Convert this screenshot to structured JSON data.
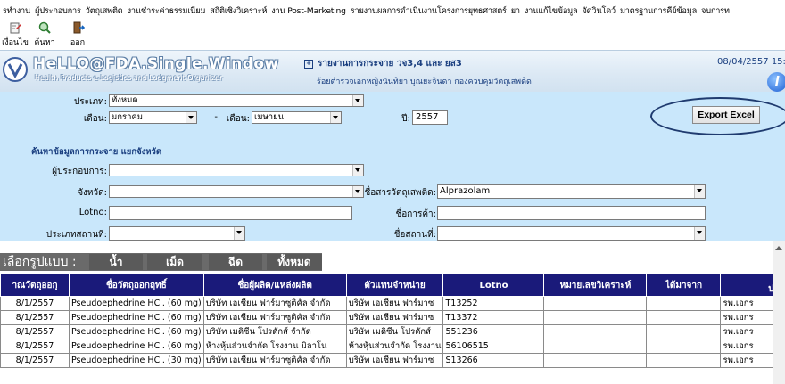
{
  "menu": [
    "รทำงาน",
    "ผู้ประกอบการ",
    "วัตถุเสพติด",
    "งานชำระค่าธรรมเนียม",
    "สถิติเชิงวิเคราะห์",
    "งาน Post-Marketing",
    "รายงานผลการดำเนินงานโครงการยุทธศาสตร์",
    "ยา",
    "งานแก้ไขข้อมูล",
    "จัดวินโดว์",
    "มาตรฐานการคีย์ข้อมูล",
    "จบการท"
  ],
  "toolbar": {
    "conditions": "เงื่อนไข",
    "search": "ค้นหา",
    "exit": "ออก"
  },
  "header": {
    "logo_title": "HeLLO@FDA.Single.Window",
    "logo_sub": "Health Products e-Logistics and Lodgment Organizer",
    "report_title": "รายงานการกระจาย วจ3,4 และ ยส3",
    "user_line": "ร้อยตำรวจเอกหญิงนันทิยา บุณยะจินดา กองควบคุมวัตถุเสพติด",
    "date": "08/04/2557 15:13"
  },
  "form": {
    "type_label": "ประเภท:",
    "type_value": "ทั้งหมด",
    "month_label": "เดือน:",
    "month_from": "มกราคม",
    "dash": "-",
    "month_to_label": "เดือน:",
    "month_to": "เมษายน",
    "year_label": "ปี:",
    "year_value": "2557",
    "section_title": "ค้นหาข้อมูลการกระจาย แยกจังหวัด",
    "operator_label": "ผู้ประกอบการ:",
    "province_label": "จังหวัด:",
    "substance_label": "ชื่อสารวัตถุเสพติด:",
    "substance_value": "Alprazolam",
    "lotno_label": "Lotno:",
    "trade_label": "ชื่อการค้า:",
    "place_type_label": "ประเภทสถานที่:",
    "place_name_label": "ชื่อสถานที่:",
    "export_label": "Export Excel"
  },
  "tabs": {
    "label": "เลือกรูปแบบ :",
    "items": [
      "น้ำ",
      "เม็ด",
      "ฉีด",
      "ทั้งหมด"
    ]
  },
  "table": {
    "headers": [
      "าณวัตถุออกุ",
      "ชื่อวัตถุออกฤทธิ์",
      "ชื่อผู้ผลิต/แหล่งผลิต",
      "ตัวแทนจำหน่าย",
      "Lotno",
      "หมายเลขวิเคราะห์",
      "ได้มาจาก",
      "ป"
    ],
    "rows": [
      [
        "8/1/2557",
        "Pseudoephedrine HCl. (60 mg)",
        "บริษัท เอเชียน ฟาร์มาซูติคัล จำกัด",
        "บริษัท เอเชียน ฟาร์มาซ",
        "T13252",
        "",
        "",
        "รพ.เอกร"
      ],
      [
        "8/1/2557",
        "Pseudoephedrine HCl. (60 mg)",
        "บริษัท เอเชียน ฟาร์มาซูติคัล จำกัด",
        "บริษัท เอเชียน ฟาร์มาซ",
        "T13372",
        "",
        "",
        "รพ.เอกร"
      ],
      [
        "8/1/2557",
        "Pseudoephedrine HCl. (60 mg)",
        "บริษัท เมดิซีน โปรดักส์ จำกัด",
        "บริษัท เมดิซีน โปรดักส์",
        "551236",
        "",
        "",
        "รพ.เอกร"
      ],
      [
        "8/1/2557",
        "Pseudoephedrine HCl. (60 mg)",
        "ห้างหุ้นส่วนจำกัด โรงงาน มิลาโน",
        "ห้างหุ้นส่วนจำกัด โรงงาน",
        "56106515",
        "",
        "",
        "รพ.เอกร"
      ],
      [
        "8/1/2557",
        "Pseudoephedrine HCl. (30 mg)",
        "บริษัท เอเชียน ฟาร์มาซูติคัล จำกัด",
        "บริษัท เอเชียน ฟาร์มาซ",
        "S13266",
        "",
        "",
        "รพ.เอกร"
      ]
    ]
  }
}
